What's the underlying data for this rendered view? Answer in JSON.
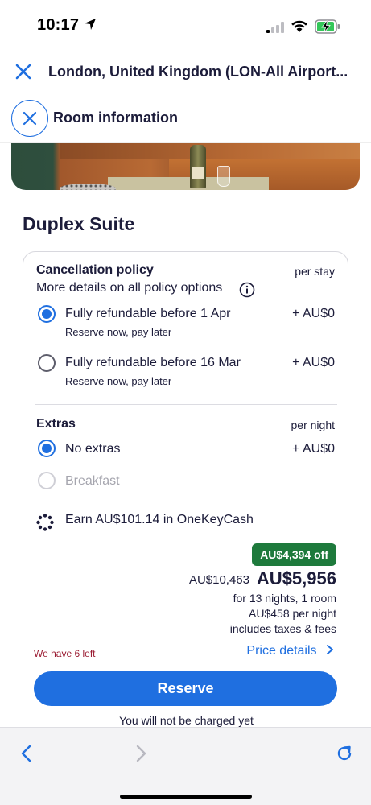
{
  "status": {
    "time": "10:17",
    "icons": [
      "location-arrow-icon",
      "signal-icon",
      "wifi-icon",
      "battery-charging-icon"
    ]
  },
  "header": {
    "title": "London, United Kingdom (LON-All Airport...",
    "close_icon": "close-icon"
  },
  "room_bar": {
    "title": "Room information",
    "close_icon": "close-icon"
  },
  "room": {
    "name": "Duplex Suite"
  },
  "cancellation": {
    "heading": "Cancellation policy",
    "unit": "per stay",
    "link": "More details on all policy options",
    "options": [
      {
        "label": "Fully refundable before 1 Apr",
        "sub": "Reserve now, pay later",
        "price": "+ AU$0",
        "selected": true
      },
      {
        "label": "Fully refundable before 16 Mar",
        "sub": "Reserve now, pay later",
        "price": "+ AU$0",
        "selected": false
      }
    ]
  },
  "extras": {
    "heading": "Extras",
    "unit": "per night",
    "options": [
      {
        "label": "No extras",
        "price": "+ AU$0",
        "selected": true,
        "disabled": false
      },
      {
        "label": "Breakfast",
        "price": "",
        "selected": false,
        "disabled": true
      }
    ]
  },
  "onekeycash": {
    "text": "Earn AU$101.14 in OneKeyCash"
  },
  "pricing": {
    "discount": "AU$4,394 off",
    "old_price": "AU$10,463",
    "new_price": "AU$5,956",
    "line1": "for 13 nights, 1 room",
    "line2": "AU$458 per night",
    "line3": "includes taxes & fees",
    "remaining": "We have 6 left",
    "details_link": "Price details",
    "reserve": "Reserve",
    "no_charge": "You will not be charged yet"
  },
  "colors": {
    "accent": "#1f6fe0",
    "discount_green": "#1e7a3c",
    "urgency_red": "#9b1d33",
    "text": "#1c1c3a"
  },
  "toolbar": {
    "icons": [
      "back-icon",
      "forward-icon",
      "reload-icon"
    ]
  }
}
